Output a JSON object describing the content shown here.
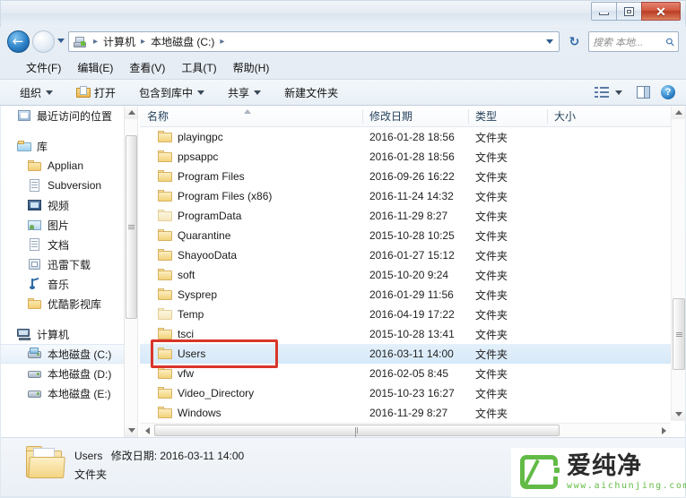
{
  "window": {
    "buttons": {
      "minimize": "minimize-box",
      "maximize": "maximize-box",
      "close": "✕"
    }
  },
  "nav": {
    "back_glyph": "←",
    "breadcrumb": [
      "计算机",
      "本地磁盘 (C:)"
    ],
    "separator": "▸",
    "refresh_glyph": "↻"
  },
  "search": {
    "placeholder": "搜索 本地...",
    "icon": "search-icon"
  },
  "menu": {
    "items": [
      "文件(F)",
      "编辑(E)",
      "查看(V)",
      "工具(T)",
      "帮助(H)"
    ]
  },
  "toolbar": {
    "organize": "组织",
    "open": "打开",
    "include_in_library": "包含到库中",
    "share": "共享",
    "new_folder": "新建文件夹"
  },
  "sidebar": {
    "items": [
      {
        "label": "最近访问的位置",
        "icon": "recent-places-icon",
        "indent": false,
        "selected": false
      },
      {
        "label": "库",
        "icon": "library-icon",
        "indent": false,
        "selected": false
      },
      {
        "label": "Applian",
        "icon": "folder-icon",
        "indent": true,
        "selected": false
      },
      {
        "label": "Subversion",
        "icon": "document-icon",
        "indent": true,
        "selected": false
      },
      {
        "label": "视频",
        "icon": "video-icon",
        "indent": true,
        "selected": false
      },
      {
        "label": "图片",
        "icon": "pictures-icon",
        "indent": true,
        "selected": false
      },
      {
        "label": "文档",
        "icon": "document-icon",
        "indent": true,
        "selected": false
      },
      {
        "label": "迅雷下载",
        "icon": "downloads-icon",
        "indent": true,
        "selected": false
      },
      {
        "label": "音乐",
        "icon": "music-icon",
        "indent": true,
        "selected": false
      },
      {
        "label": "优酷影视库",
        "icon": "folder-icon",
        "indent": true,
        "selected": false
      },
      {
        "label": "计算机",
        "icon": "computer-icon",
        "indent": false,
        "selected": false
      },
      {
        "label": "本地磁盘 (C:)",
        "icon": "system-drive-icon",
        "indent": true,
        "selected": true
      },
      {
        "label": "本地磁盘 (D:)",
        "icon": "drive-icon",
        "indent": true,
        "selected": false
      },
      {
        "label": "本地磁盘 (E:)",
        "icon": "drive-icon",
        "indent": true,
        "selected": false
      }
    ]
  },
  "filelist": {
    "columns": [
      "名称",
      "修改日期",
      "类型",
      "大小"
    ],
    "rows": [
      {
        "name": "playingpc",
        "date": "2016-01-28 18:56",
        "type": "文件夹",
        "size": "",
        "selected": false,
        "pale": false
      },
      {
        "name": "ppsappc",
        "date": "2016-01-28 18:56",
        "type": "文件夹",
        "size": "",
        "selected": false,
        "pale": false
      },
      {
        "name": "Program Files",
        "date": "2016-09-26 16:22",
        "type": "文件夹",
        "size": "",
        "selected": false,
        "pale": false
      },
      {
        "name": "Program Files (x86)",
        "date": "2016-11-24 14:32",
        "type": "文件夹",
        "size": "",
        "selected": false,
        "pale": false
      },
      {
        "name": "ProgramData",
        "date": "2016-11-29 8:27",
        "type": "文件夹",
        "size": "",
        "selected": false,
        "pale": true
      },
      {
        "name": "Quarantine",
        "date": "2015-10-28 10:25",
        "type": "文件夹",
        "size": "",
        "selected": false,
        "pale": false
      },
      {
        "name": "ShayooData",
        "date": "2016-01-27 15:12",
        "type": "文件夹",
        "size": "",
        "selected": false,
        "pale": false
      },
      {
        "name": "soft",
        "date": "2015-10-20 9:24",
        "type": "文件夹",
        "size": "",
        "selected": false,
        "pale": false
      },
      {
        "name": "Sysprep",
        "date": "2016-01-29 11:56",
        "type": "文件夹",
        "size": "",
        "selected": false,
        "pale": false
      },
      {
        "name": "Temp",
        "date": "2016-04-19 17:22",
        "type": "文件夹",
        "size": "",
        "selected": false,
        "pale": true
      },
      {
        "name": "tsci",
        "date": "2015-10-28 13:41",
        "type": "文件夹",
        "size": "",
        "selected": false,
        "pale": false
      },
      {
        "name": "Users",
        "date": "2016-03-11 14:00",
        "type": "文件夹",
        "size": "",
        "selected": true,
        "pale": false
      },
      {
        "name": "vfw",
        "date": "2016-02-05 8:45",
        "type": "文件夹",
        "size": "",
        "selected": false,
        "pale": false
      },
      {
        "name": "Video_Directory",
        "date": "2015-10-23 16:27",
        "type": "文件夹",
        "size": "",
        "selected": false,
        "pale": false
      },
      {
        "name": "Windows",
        "date": "2016-11-29 8:27",
        "type": "文件夹",
        "size": "",
        "selected": false,
        "pale": false
      }
    ]
  },
  "status": {
    "name": "Users",
    "modified_label": "修改日期:",
    "modified_value": "2016-03-11 14:00",
    "type": "文件夹"
  },
  "watermark": {
    "brand": "爱纯净",
    "url": "www.aichunjing.com"
  },
  "colors": {
    "selection": "#d6e9f9",
    "highlight_box": "#d9362b",
    "brand_green": "#62bb46",
    "close_red": "#b93d26"
  }
}
